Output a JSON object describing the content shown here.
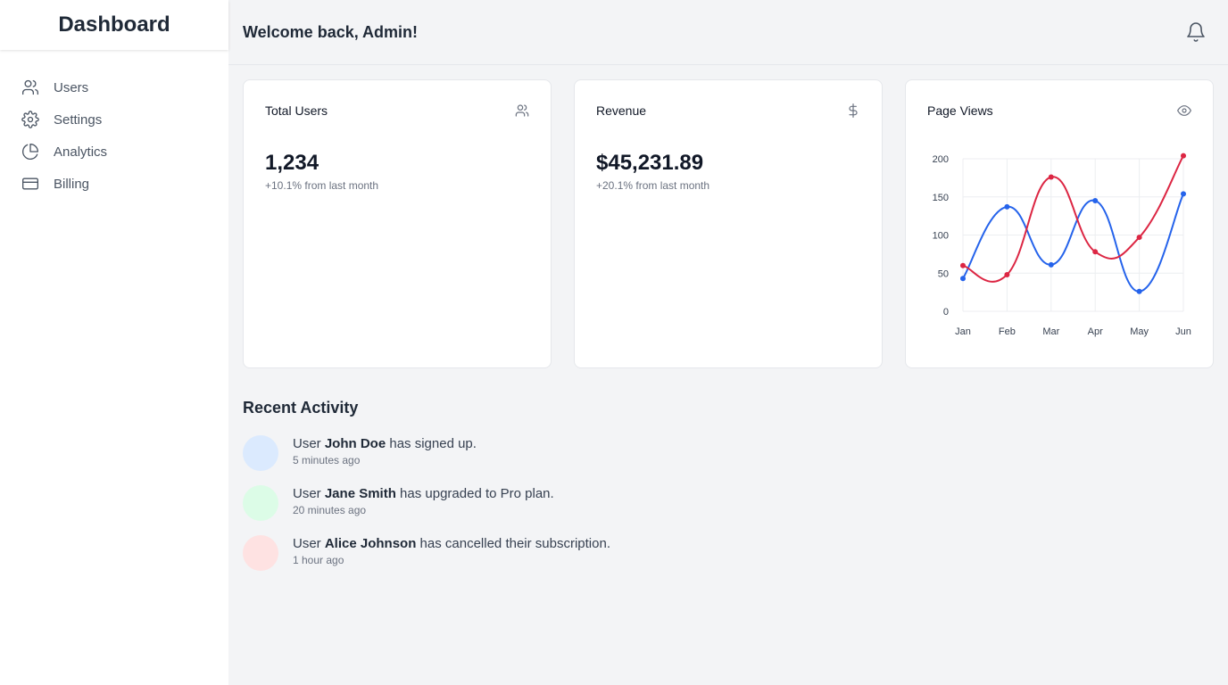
{
  "sidebar": {
    "title": "Dashboard",
    "items": [
      {
        "label": "Users",
        "icon": "users-icon"
      },
      {
        "label": "Settings",
        "icon": "gear-icon"
      },
      {
        "label": "Analytics",
        "icon": "pie-chart-icon"
      },
      {
        "label": "Billing",
        "icon": "credit-card-icon"
      }
    ]
  },
  "header": {
    "welcome": "Welcome back, Admin!",
    "bell_icon": "bell-icon"
  },
  "cards": {
    "users": {
      "title": "Total Users",
      "value": "1,234",
      "sub": "+10.1% from last month",
      "icon": "users-icon"
    },
    "revenue": {
      "title": "Revenue",
      "value": "$45,231.89",
      "sub": "+20.1% from last month",
      "icon": "dollar-icon"
    },
    "views": {
      "title": "Page Views",
      "icon": "eye-icon"
    }
  },
  "chart_data": {
    "type": "line",
    "title": "",
    "x": [
      "Jan",
      "Feb",
      "Mar",
      "Apr",
      "May",
      "Jun"
    ],
    "ylim": [
      0,
      200
    ],
    "yticks": [
      0,
      50,
      100,
      150,
      200
    ],
    "grid": true,
    "series": [
      {
        "values": [
          43,
          137,
          61,
          145,
          26,
          154
        ],
        "color": "#2563eb"
      },
      {
        "values": [
          60,
          48,
          176,
          78,
          97,
          204
        ],
        "color": "#dc2643"
      }
    ]
  },
  "activity": {
    "title": "Recent Activity",
    "items": [
      {
        "prefix": "User ",
        "name": "John Doe",
        "suffix": " has signed up.",
        "time": "5 minutes ago",
        "color": "#dbeafe"
      },
      {
        "prefix": "User ",
        "name": "Jane Smith",
        "suffix": " has upgraded to Pro plan.",
        "time": "20 minutes ago",
        "color": "#dcfce7"
      },
      {
        "prefix": "User ",
        "name": "Alice Johnson",
        "suffix": " has cancelled their subscription.",
        "time": "1 hour ago",
        "color": "#fee2e2"
      }
    ]
  }
}
